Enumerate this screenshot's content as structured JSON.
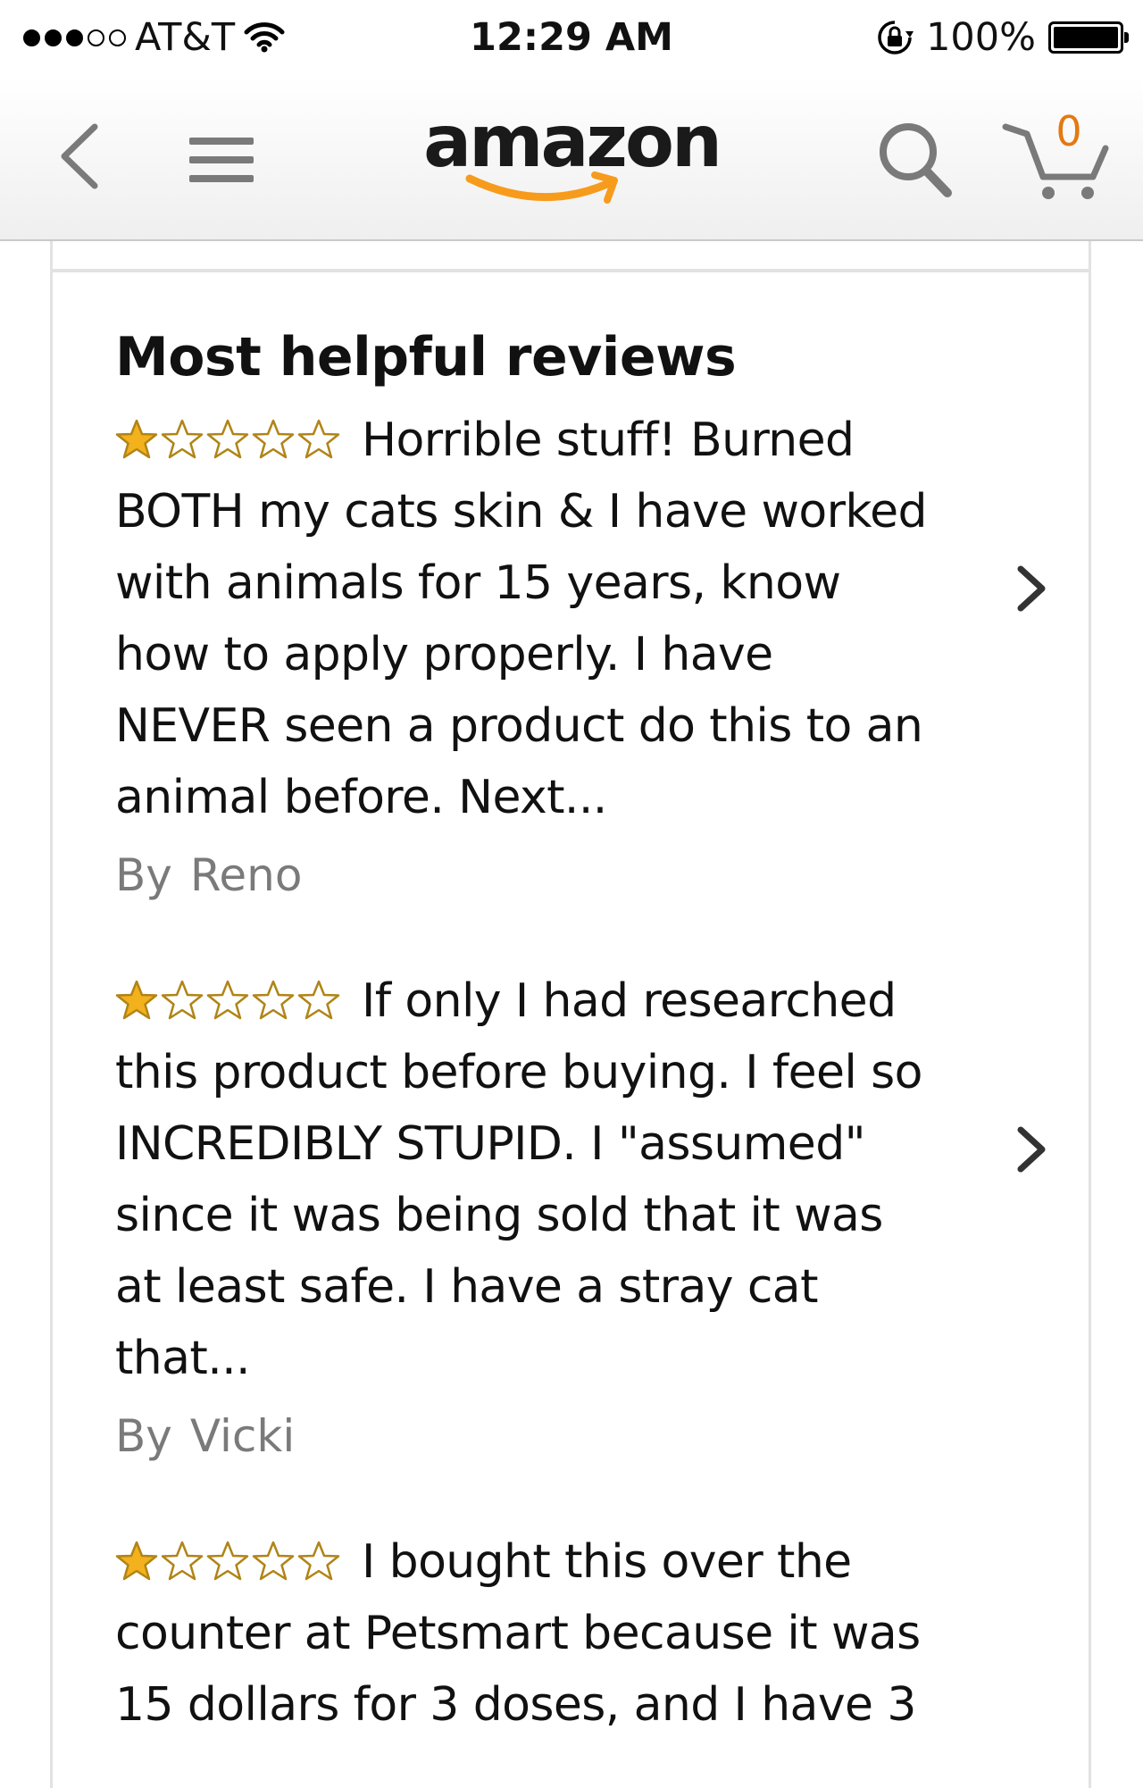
{
  "status_bar": {
    "carrier": "AT&T",
    "time": "12:29 AM",
    "battery": "100%"
  },
  "nav": {
    "logo": "amazon",
    "cart_count": "0",
    "colors": {
      "logo_smile": "#f79b1c",
      "cart_count": "#e47911"
    }
  },
  "reviews_section": {
    "title": "Most helpful reviews",
    "reviews": [
      {
        "rating": 1,
        "max_rating": 5,
        "text": "Horrible stuff! Burned BOTH my cats skin & I have worked with animals for 15 years, know how to apply properly. I have NEVER seen a product do this to an animal before. Next...",
        "by_label": "By",
        "author": "Reno"
      },
      {
        "rating": 1,
        "max_rating": 5,
        "text": "If only I had researched this product before buying. I feel so INCREDIBLY STUPID. I \"assumed\" since it was being sold that it was at least safe. I have a stray cat that...",
        "by_label": "By",
        "author": "Vicki"
      },
      {
        "rating": 1,
        "max_rating": 5,
        "text": "I bought this over the counter at Petsmart because it was 15 dollars for 3 doses, and I have 3",
        "by_label": "",
        "author": ""
      }
    ],
    "colors": {
      "star_filled": "#f3b11d",
      "star_outline": "#b08416"
    }
  }
}
